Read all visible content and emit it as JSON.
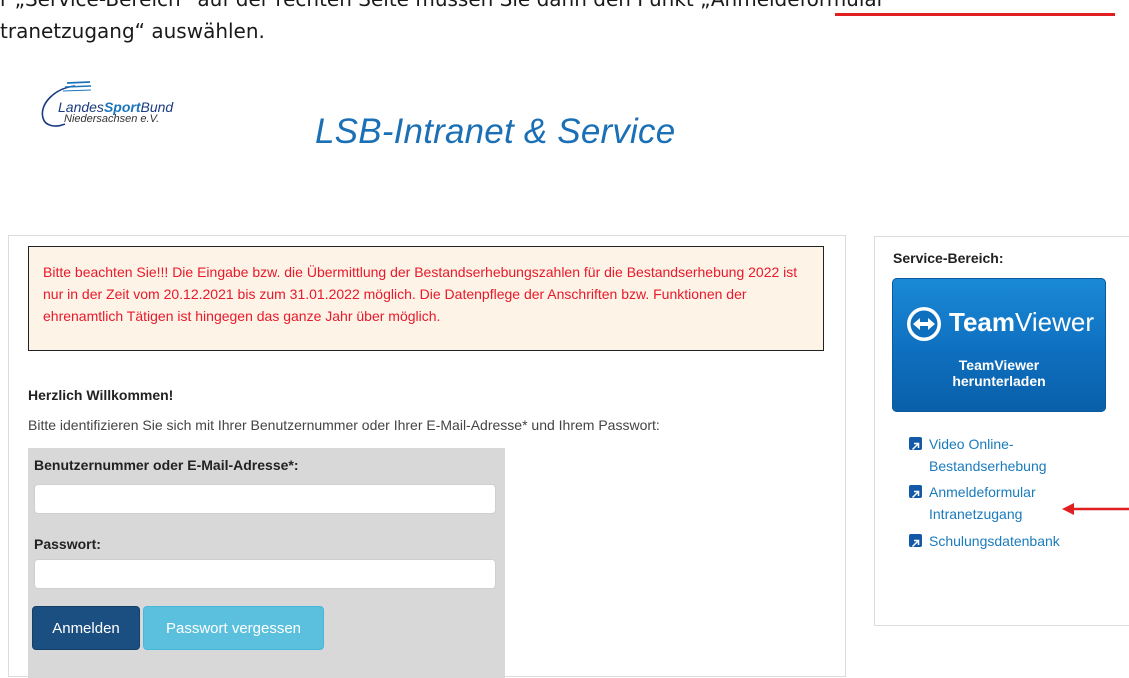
{
  "doc_instruction": {
    "line1": "r „Service-Bereich“ auf der rechten Seite müssen Sie dann den Punkt „Anmeldeformular",
    "line2": "tranetzugang“ auswählen."
  },
  "header": {
    "logo_line1_a": "Landes",
    "logo_line1_b": "Sport",
    "logo_line1_c": "Bund",
    "logo_line2": "Niedersachsen e.V.",
    "title": "LSB-Intranet & Service"
  },
  "notice": {
    "text": "Bitte beachten Sie!!! Die Eingabe bzw. die Übermittlung der Bestandserhebungszahlen für die Bestandserhebung 2022 ist nur in der Zeit vom 20.12.2021 bis zum 31.01.2022 möglich. Die Datenpflege der Anschriften bzw. Funktionen der ehrenamtlich Tätigen ist hingegen das ganze Jahr über möglich."
  },
  "welcome": {
    "title": "Herzlich Willkommen!",
    "text": "Bitte identifizieren Sie sich mit Ihrer Benutzernummer oder Ihrer E-Mail-Adresse* und Ihrem Passwort:"
  },
  "login": {
    "user_label": "Benutzernummer oder E-Mail-Adresse*:",
    "user_value": "",
    "pass_label": "Passwort:",
    "pass_value": "",
    "login_button": "Anmelden",
    "forgot_button": "Passwort vergessen"
  },
  "sidebar": {
    "title": "Service-Bereich:",
    "teamviewer_brand_bold": "Team",
    "teamviewer_brand_light": "Viewer",
    "teamviewer_sub1": "TeamViewer",
    "teamviewer_sub2": "herunterladen",
    "links": [
      {
        "label_line1": "Video Online-",
        "label_line2": "Bestandserhebung"
      },
      {
        "label_line1": "Anmeldeformular",
        "label_line2": "Intranetzugang"
      },
      {
        "label_line1": "Schulungsdatenbank",
        "label_line2": ""
      }
    ]
  },
  "colors": {
    "notice_text": "#e8192c",
    "notice_bg": "#fdf3e6",
    "link": "#1a7bbd",
    "login_button": "#1b4f82",
    "forgot_button": "#5bc0de",
    "annotation": "#e02020"
  },
  "icons": {
    "teamviewer": "teamviewer-logo-icon",
    "external_link": "external-link-icon",
    "annotation_arrow": "arrow-left-icon"
  }
}
